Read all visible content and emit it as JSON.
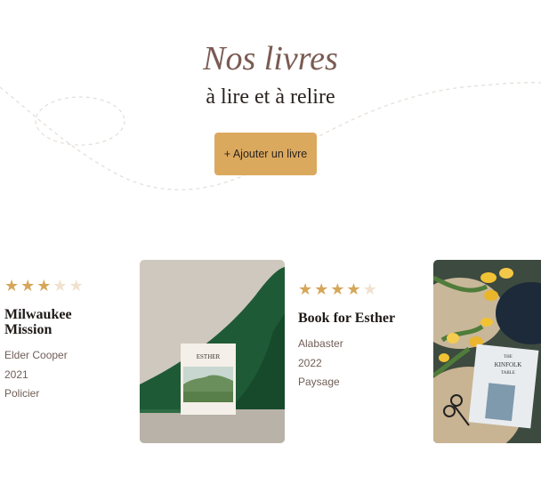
{
  "hero": {
    "title": "Nos livres",
    "subtitle": "à lire et à relire",
    "add_button_label": "+ Ajouter un livre"
  },
  "colors": {
    "accent": "#dba95e",
    "title": "#7a5b52",
    "star_full": "#d6a659",
    "star_empty": "#efe2cf"
  },
  "books": [
    {
      "title": "Milwaukee Mission",
      "author": "Elder Cooper",
      "year": "2021",
      "genre": "Policier",
      "rating": 3,
      "max_rating": 5
    },
    {
      "title": "Book for Esther",
      "author": "Alabaster",
      "year": "2022",
      "genre": "Paysage",
      "rating": 4,
      "max_rating": 5,
      "cover_text": "ESTHER"
    }
  ],
  "third_cover_text": {
    "line1": "THE",
    "line2": "KINFOLK",
    "line3": "TABLE"
  }
}
